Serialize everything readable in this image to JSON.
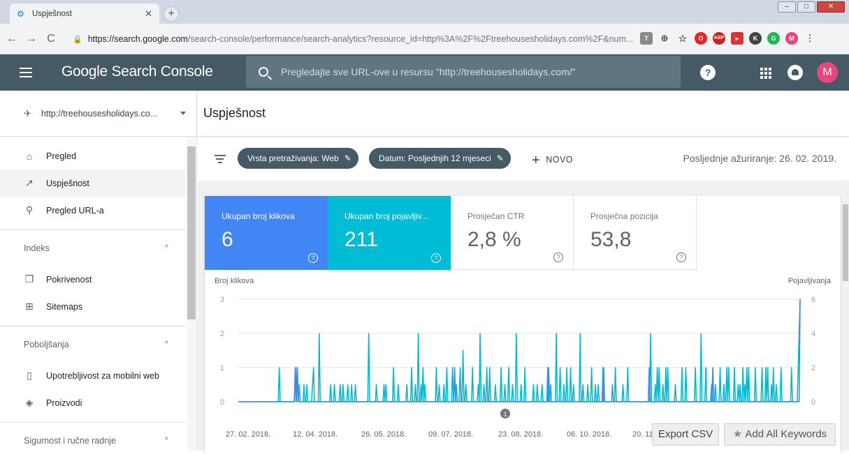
{
  "browser": {
    "tab_title": "Uspješnost",
    "url_host": "https://search.google.com",
    "url_path": "/search-console/performance/search-analytics?resource_id=http%3A%2F%2Ftreehousesholidays.com%2F&num..."
  },
  "header": {
    "brand": "Google Search Console",
    "search_placeholder": "Pregledajte sve URL-ove u resursu \"http://treehousesholidays.com/\"",
    "avatar_letter": "M"
  },
  "sidebar": {
    "property": "http://treehousesholidays.co...",
    "items_top": [
      {
        "label": "Pregled",
        "icon": "home-icon"
      },
      {
        "label": "Uspješnost",
        "icon": "trending-up-icon"
      },
      {
        "label": "Pregled URL-a",
        "icon": "search-icon"
      }
    ],
    "section_index": "Indeks",
    "items_index": [
      {
        "label": "Pokrivenost",
        "icon": "copy-icon"
      },
      {
        "label": "Sitemaps",
        "icon": "sitemap-icon"
      }
    ],
    "section_improvements": "Poboljšanja",
    "items_improvements": [
      {
        "label": "Upotrebljivost za mobilni web",
        "icon": "phone-icon"
      },
      {
        "label": "Proizvodi",
        "icon": "layers-icon"
      }
    ],
    "section_security": "Sigurnost i ručne radnje"
  },
  "main": {
    "title": "Uspješnost",
    "filter_chip_1": "Vrsta pretraživanja: Web",
    "filter_chip_2": "Datum: Posljednjih 12 mjeseci",
    "new_label": "NOVO",
    "updated": "Posljednje ažuriranje: 26. 02. 2019."
  },
  "metrics": [
    {
      "label": "Ukupan broj klikova",
      "value": "6"
    },
    {
      "label": "Ukupan broj pojavljiv...",
      "value": "211"
    },
    {
      "label": "Prosječan CTR",
      "value": "2,8 %"
    },
    {
      "label": "Prosječna pozicija",
      "value": "53,8"
    }
  ],
  "colors": {
    "clicks": "#4285f4",
    "impressions": "#00bcd4",
    "header": "#455a64"
  },
  "chart_data": {
    "type": "line",
    "ylabel_left": "Broj klikova",
    "ylabel_right": "Pojavljivanja",
    "ylim_left": [
      0,
      3
    ],
    "ylim_right": [
      0,
      6
    ],
    "yticks_left": [
      "0",
      "1",
      "2",
      "3"
    ],
    "yticks_right": [
      "0",
      "2",
      "4",
      "6"
    ],
    "xticks": [
      "27. 02. 2018.",
      "12. 04. 2018.",
      "26. 05. 2018.",
      "09. 07. 2018.",
      "23. 08. 2018.",
      "06. 10. 2018.",
      "20. 11."
    ],
    "annotation": "1",
    "series": [
      {
        "name": "Ukupan broj klikova",
        "color": "#4285f4",
        "values": [
          0,
          0,
          0,
          0,
          0,
          0,
          0,
          0,
          0,
          0,
          0,
          0,
          0,
          0,
          0,
          0,
          0,
          0,
          0,
          0,
          0,
          0,
          0,
          0,
          0,
          0,
          0,
          0,
          0,
          0,
          0,
          0,
          0,
          0,
          0,
          0,
          0,
          0,
          0,
          0,
          0,
          0,
          0,
          0,
          0,
          0,
          0,
          0,
          0,
          0,
          0,
          0,
          0,
          0,
          0,
          0,
          0,
          0,
          0,
          0,
          1,
          0,
          1,
          0,
          0,
          0,
          0,
          0,
          0,
          0,
          0,
          0,
          0,
          0,
          0,
          0,
          0,
          0,
          0,
          0,
          0,
          0,
          0,
          0,
          0,
          0,
          0,
          0,
          0,
          0,
          0,
          0,
          0,
          0,
          0,
          0,
          0,
          0,
          0,
          0,
          0,
          0,
          0,
          0,
          0,
          0,
          0,
          0,
          0,
          0,
          0,
          0,
          0,
          0,
          0,
          0,
          0,
          0,
          0,
          0,
          0,
          0,
          0,
          0,
          0,
          0,
          0,
          0,
          0,
          0,
          0,
          0,
          0,
          0,
          0,
          0,
          0,
          0,
          0,
          0,
          0,
          0,
          0,
          0,
          0,
          0,
          0,
          0,
          0,
          0,
          0,
          0,
          0,
          0,
          0,
          0,
          0,
          0,
          0,
          0,
          0,
          0,
          0,
          0,
          0,
          0,
          0,
          0,
          0,
          0,
          0,
          0,
          0,
          0,
          0,
          0,
          0,
          0,
          0,
          0,
          0,
          0,
          0,
          0,
          0,
          0,
          0,
          0,
          0,
          0,
          0,
          0,
          0,
          0,
          0,
          0,
          0,
          0,
          0,
          0,
          0,
          0,
          0,
          0,
          0,
          0,
          0,
          0,
          0,
          0,
          0,
          0,
          0,
          0,
          0,
          0,
          0,
          0,
          0,
          0,
          0,
          0,
          0,
          0,
          0,
          0,
          0,
          0,
          1,
          0,
          0,
          0,
          0,
          0,
          0,
          0,
          0,
          0,
          0,
          0,
          0,
          0,
          0,
          0,
          0,
          0,
          0,
          0,
          0,
          0,
          0,
          0,
          0,
          0,
          0,
          0,
          0,
          0,
          0,
          0,
          0,
          0,
          0,
          0,
          0,
          0,
          0,
          0,
          0,
          0,
          0,
          0,
          0,
          0,
          0,
          0,
          0,
          0,
          0,
          0,
          0,
          0,
          0,
          0,
          0,
          0,
          0,
          0,
          0,
          0,
          0,
          0,
          0,
          0,
          0,
          0,
          0,
          0,
          0,
          0,
          0,
          0,
          0,
          0,
          0,
          0,
          0,
          0,
          0,
          0,
          0,
          0,
          0,
          0,
          0,
          0,
          0,
          0,
          0,
          0,
          0,
          0,
          0,
          0,
          0,
          0,
          0,
          1,
          0,
          0,
          0,
          0,
          0,
          0,
          0,
          0,
          0,
          0,
          0,
          0,
          0,
          0,
          0,
          0,
          0,
          0,
          0,
          0,
          0,
          0,
          0,
          0,
          0,
          0,
          0,
          0,
          0,
          0,
          0,
          0,
          0,
          0,
          0,
          0,
          0,
          0,
          0,
          0,
          0,
          0,
          0,
          0,
          0,
          0,
          0,
          0,
          0,
          0,
          0,
          0,
          0,
          0,
          0,
          0,
          0,
          1,
          0,
          0,
          0,
          0,
          0,
          0,
          0,
          0,
          0,
          0,
          0,
          0,
          0,
          0,
          0,
          0,
          0,
          0,
          0,
          0,
          0,
          0,
          0,
          0,
          0,
          0,
          0,
          0,
          0,
          0,
          0,
          0,
          0,
          0,
          0,
          0,
          0,
          0,
          0,
          0,
          0,
          0,
          0,
          0,
          0,
          0,
          0,
          1,
          0,
          0,
          0,
          0,
          0,
          0,
          0,
          0,
          0,
          0,
          0,
          0,
          0,
          0,
          0,
          0,
          0,
          0,
          0,
          0,
          0,
          0,
          0,
          0,
          0,
          0,
          0,
          0,
          0,
          0,
          0,
          0,
          0,
          0,
          0,
          0,
          0,
          0,
          0,
          0,
          0,
          0,
          0,
          0,
          0,
          0,
          0,
          0,
          0,
          0,
          0,
          0,
          0,
          0,
          0,
          0,
          0,
          0,
          0,
          0,
          0,
          0,
          0,
          0,
          0,
          0,
          1,
          0,
          0,
          0,
          0,
          0,
          0,
          0,
          0,
          0,
          0,
          0,
          0,
          0,
          0,
          0,
          0,
          0,
          0,
          0,
          0,
          0,
          0,
          0,
          0,
          0,
          0,
          0,
          0,
          0,
          0,
          0,
          0,
          0,
          0,
          0,
          0,
          0,
          0,
          0,
          0,
          0,
          0,
          0,
          0,
          0,
          0,
          0,
          0,
          0,
          0,
          0,
          0,
          0,
          0,
          0,
          0,
          0,
          0,
          0,
          0,
          0,
          0,
          0,
          0,
          0,
          0,
          0,
          0,
          0,
          0,
          0,
          0,
          0,
          0,
          0,
          0,
          0,
          0,
          0,
          0,
          0,
          0,
          0,
          0,
          0,
          0,
          0,
          0,
          0,
          0,
          0,
          3
        ]
      },
      {
        "name": "Ukupan broj pojavljivanja",
        "color": "#00bcd4",
        "values": [
          0,
          0,
          0,
          0,
          0,
          0,
          0,
          0,
          0,
          0,
          0,
          0,
          0,
          0,
          0,
          0,
          0,
          0,
          0,
          0,
          0,
          0,
          0,
          0,
          0,
          0,
          0,
          0,
          0,
          0,
          0,
          0,
          0,
          0,
          0,
          0,
          0,
          0,
          0,
          0,
          0,
          0,
          0,
          2,
          0,
          0,
          0,
          0,
          0,
          0,
          0,
          0,
          0,
          0,
          0,
          0,
          0,
          0,
          0,
          0,
          2,
          0,
          2,
          0,
          1,
          0,
          0,
          0,
          0,
          1,
          0,
          0,
          1,
          0,
          0,
          0,
          0,
          0,
          1,
          2,
          0,
          0,
          0,
          0,
          0,
          4,
          0,
          0,
          0,
          0,
          0,
          0,
          0,
          0,
          0,
          0,
          0,
          1,
          0,
          0,
          0,
          1,
          0,
          0,
          0,
          0,
          0,
          1,
          0,
          0,
          1,
          0,
          0,
          0,
          0,
          1,
          0,
          0,
          0,
          1,
          0,
          0,
          0,
          1,
          0,
          0,
          0,
          0,
          0,
          0,
          0,
          0,
          0,
          0,
          0,
          0,
          0,
          4,
          0,
          0,
          0,
          0,
          0,
          0,
          0,
          1,
          0,
          0,
          0,
          0,
          0,
          0,
          0,
          1,
          0,
          1,
          0,
          0,
          0,
          0,
          0,
          0,
          0,
          2,
          0,
          0,
          0,
          0,
          1,
          0,
          0,
          0,
          0,
          0,
          0,
          0,
          0,
          1,
          0,
          0,
          0,
          0,
          2,
          0,
          0,
          0,
          1,
          0,
          0,
          4,
          0,
          0,
          1,
          0,
          2,
          0,
          1,
          0,
          0,
          0,
          0,
          0,
          0,
          0,
          0,
          0,
          0,
          0,
          2,
          0,
          0,
          1,
          0,
          0,
          0,
          0,
          1,
          0,
          0,
          2,
          0,
          0,
          0,
          0,
          0,
          2,
          0,
          0,
          0,
          1,
          0,
          0,
          0,
          2,
          0,
          0,
          3,
          0,
          0,
          1,
          0,
          0,
          0,
          0,
          0,
          0,
          2,
          0,
          0,
          0,
          0,
          0,
          1,
          0,
          4,
          0,
          0,
          0,
          1,
          0,
          0,
          2,
          0,
          0,
          2,
          0,
          0,
          0,
          0,
          0,
          1,
          0,
          0,
          0,
          0,
          0,
          2,
          0,
          0,
          0,
          1,
          0,
          0,
          0,
          2,
          0,
          0,
          0,
          1,
          0,
          0,
          0,
          4,
          0,
          0,
          0,
          0,
          1,
          0,
          0,
          0,
          2,
          0,
          0,
          0,
          0,
          0,
          0,
          0,
          0,
          1,
          0,
          0,
          0,
          1,
          0,
          0,
          0,
          0,
          1,
          0,
          0,
          0,
          0,
          0,
          2,
          0,
          0,
          1,
          0,
          0,
          0,
          0,
          0,
          4,
          0,
          0,
          0,
          2,
          0,
          0,
          0,
          1,
          0,
          0,
          2,
          0,
          0,
          0,
          2,
          0,
          0,
          1,
          0,
          0,
          0,
          0,
          0,
          0,
          4,
          0,
          0,
          1,
          0,
          0,
          0,
          0,
          1,
          0,
          0,
          0,
          2,
          0,
          0,
          0,
          1,
          0,
          0,
          1,
          0,
          0,
          0,
          0,
          2,
          0,
          0,
          0,
          0,
          0,
          0,
          0,
          0,
          0,
          1,
          0,
          0,
          2,
          0,
          0,
          0,
          0,
          0,
          0,
          0,
          1,
          0,
          0,
          0,
          0,
          2,
          0,
          0,
          0,
          0,
          0,
          0,
          0,
          0,
          0,
          0,
          0,
          0,
          0,
          0,
          0,
          0,
          0,
          0,
          0,
          0,
          0,
          0,
          0,
          4,
          0,
          0,
          0,
          0,
          1,
          0,
          2,
          0,
          2,
          0,
          0,
          0,
          1,
          0,
          0,
          2,
          0,
          2,
          0,
          0,
          0,
          0,
          0,
          0,
          0,
          1,
          0,
          0,
          0,
          0,
          0,
          0,
          2,
          0,
          0,
          0,
          2,
          0,
          0,
          0,
          0,
          0,
          0,
          0,
          0,
          0,
          2,
          0,
          0,
          0,
          0,
          0,
          4,
          0,
          0,
          0,
          0,
          2,
          0,
          0,
          0,
          0,
          0,
          1,
          0,
          0,
          0,
          1,
          0,
          0,
          0,
          0,
          2,
          0,
          0,
          0,
          1,
          0,
          0,
          2,
          0,
          2,
          0,
          0,
          0,
          0,
          0,
          2,
          0,
          0,
          0,
          1,
          0,
          1,
          0,
          0,
          2,
          0,
          1,
          0,
          2,
          0,
          2,
          0,
          0,
          0,
          0,
          0,
          0,
          2,
          0,
          0,
          0,
          0,
          0,
          0,
          2,
          0,
          0,
          0,
          2,
          0,
          2,
          0,
          0,
          0,
          1,
          0,
          2,
          0,
          0,
          1,
          0,
          0,
          0,
          0,
          2,
          0,
          0,
          0,
          0,
          0,
          0,
          0,
          0,
          0,
          0,
          2,
          0,
          0,
          0,
          0,
          0,
          0,
          2,
          4,
          6
        ]
      }
    ]
  },
  "buttons": {
    "export": "Export CSV",
    "add_keywords": "Add All Keywords"
  }
}
